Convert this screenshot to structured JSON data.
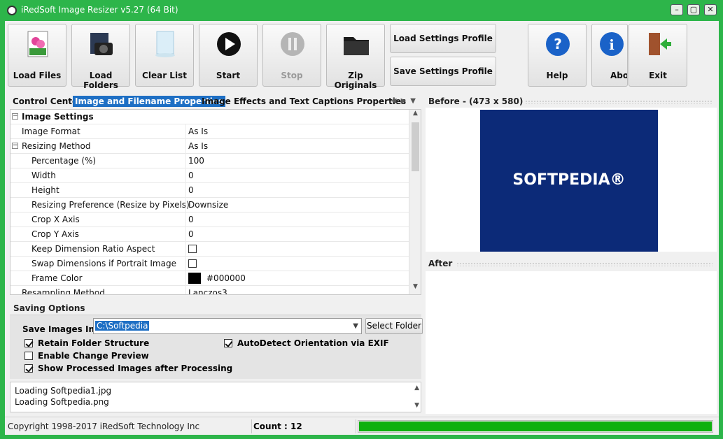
{
  "window": {
    "title": "iRedSoft Image Resizer v5.27 (64 Bit)"
  },
  "toolbar": {
    "load_files": "Load Files",
    "load_folders": "Load Folders",
    "clear_list": "Clear List",
    "start": "Start",
    "stop": "Stop",
    "zip_originals": "Zip Originals",
    "load_profile": "Load Settings Profile",
    "save_profile": "Save Settings Profile",
    "help": "Help",
    "about": "About",
    "exit": "Exit"
  },
  "tabs": [
    "Control Center",
    "Image and Filename Properties",
    "Image Effects and Text Captions Properties"
  ],
  "grid": {
    "section": "Image Settings",
    "rows": [
      {
        "label": "Image Format",
        "value": "As Is"
      },
      {
        "label": "Resizing Method",
        "value": "As Is"
      },
      {
        "label": "Percentage (%)",
        "value": "100"
      },
      {
        "label": "Width",
        "value": "0"
      },
      {
        "label": "Height",
        "value": "0"
      },
      {
        "label": "Resizing Preference (Resize by Pixels)",
        "value": "Downsize"
      },
      {
        "label": "Crop X Axis",
        "value": "0"
      },
      {
        "label": "Crop Y Axis",
        "value": "0"
      },
      {
        "label": "Keep Dimension Ratio Aspect",
        "value": ""
      },
      {
        "label": "Swap Dimensions if Portrait Image",
        "value": ""
      },
      {
        "label": "Frame Color",
        "value": "#000000"
      },
      {
        "label": "Resampling Method",
        "value": "Lanczos3"
      }
    ]
  },
  "saving": {
    "title": "Saving Options",
    "save_label": "Save Images In",
    "path": "C:\\Softpedia",
    "select_folder": "Select Folder",
    "options": {
      "retain": "Retain Folder Structure",
      "preview": "Enable Change Preview",
      "show_processed": "Show Processed Images after Processing",
      "autodetect": "AutoDetect Orientation via EXIF"
    }
  },
  "log": [
    "Loading Softpedia1.jpg",
    "Loading Softpedia.png"
  ],
  "preview": {
    "before_title": "Before - (473 x 580)",
    "after_title": "After",
    "image_text": "SOFTPEDIA®"
  },
  "status": {
    "copyright": "Copyright 1998-2017 iRedSoft Technology Inc",
    "count": "Count : 12",
    "progress": 1.0
  },
  "colors": {
    "frame": "#2db54a",
    "accent": "#1e6fc4",
    "progress": "#0fb00f",
    "preview_bg": "#0c2a78"
  }
}
